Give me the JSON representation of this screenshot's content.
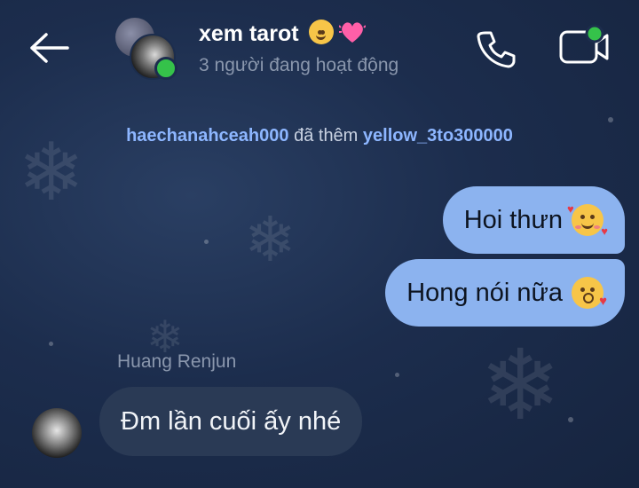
{
  "header": {
    "title": "xem tarot",
    "title_emojis": [
      "yum-face-icon",
      "pink-heart-icon"
    ],
    "status": "3 người đang hoạt động",
    "icons": {
      "back": "back-arrow-icon",
      "call": "phone-icon",
      "video": "video-call-icon"
    }
  },
  "system_message": {
    "actor": "haechanahceah000",
    "action": "đã thêm",
    "target": "yellow_3to300000"
  },
  "messages": [
    {
      "direction": "outgoing",
      "text": "Hoi thưn",
      "emoji": "smiling-face-with-hearts-icon"
    },
    {
      "direction": "outgoing",
      "text": "Hong nói nữa",
      "emoji": "face-blowing-kiss-icon"
    },
    {
      "direction": "incoming",
      "sender": "Huang Renjun",
      "text": "Đm lần cuối ấy nhé"
    }
  ],
  "colors": {
    "background": "#1c2d4d",
    "outgoing_bubble": "#8cb3ef",
    "incoming_bubble": "#2a3a55",
    "online_green": "#35c24a",
    "username_link": "#8db6ff"
  }
}
